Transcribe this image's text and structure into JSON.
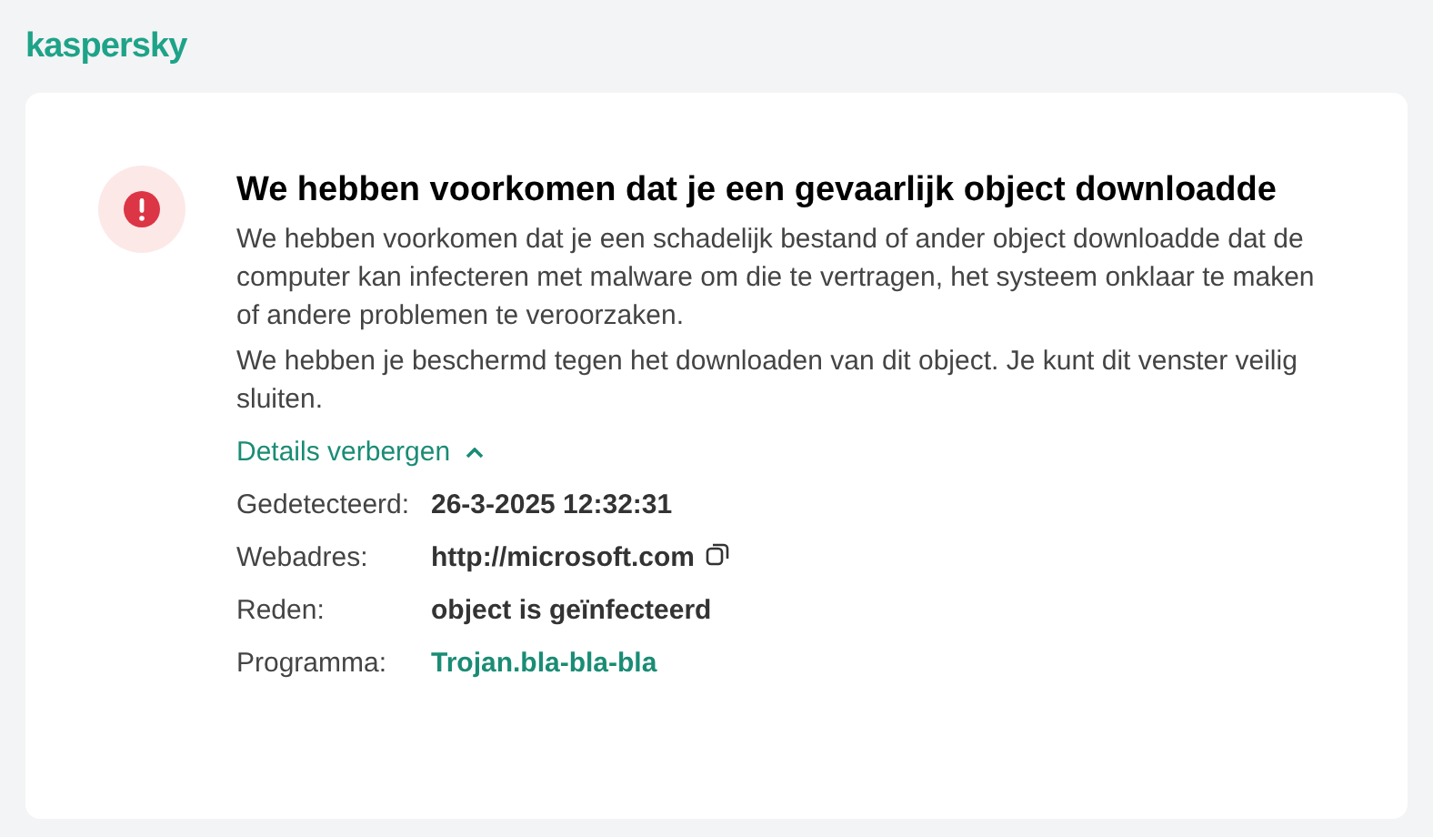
{
  "logo": "kaspersky",
  "title": "We hebben voorkomen dat je een gevaarlijk object downloadde",
  "paragraphs": [
    "We hebben voorkomen dat je een schadelijk bestand of ander object downloadde dat de computer kan infecteren met malware om die te vertragen, het systeem onklaar te maken of andere problemen te veroorzaken.",
    "We hebben je beschermd tegen het downloaden van dit object. Je kunt dit venster veilig sluiten."
  ],
  "details_toggle": {
    "label": "Details verbergen",
    "expanded": true
  },
  "details": [
    {
      "label": "Gedetecteerd:",
      "value": "26-3-2025 12:32:31",
      "kind": "text",
      "copyable": false
    },
    {
      "label": "Webadres:",
      "value": "http://microsoft.com",
      "kind": "text",
      "copyable": true
    },
    {
      "label": "Reden:",
      "value": "object is geïnfecteerd",
      "kind": "text",
      "copyable": false
    },
    {
      "label": "Programma:",
      "value": "Trojan.bla-bla-bla",
      "kind": "link",
      "copyable": false
    }
  ]
}
